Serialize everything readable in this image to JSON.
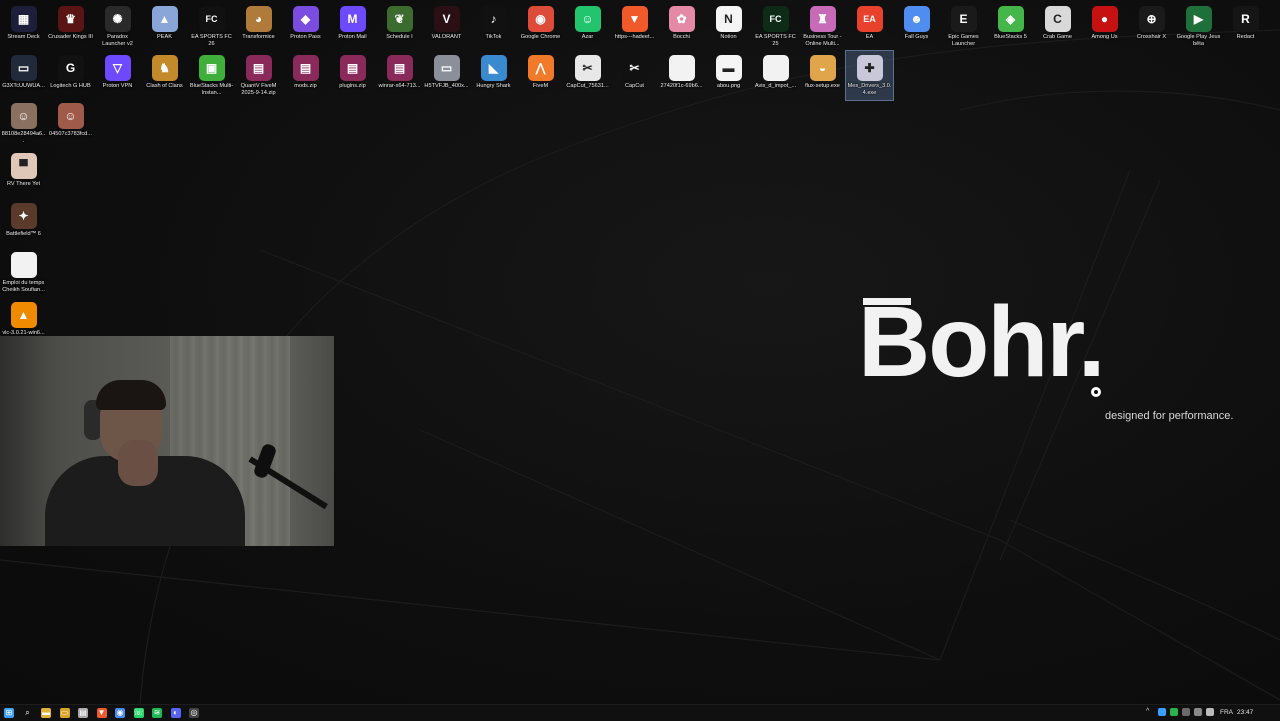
{
  "brand": {
    "name": "Bohr.",
    "tagline": "designed for performance."
  },
  "desktop_icons": [
    {
      "label": "Stream Deck",
      "icon": "stream-deck-icon",
      "color": "#1d1f3a",
      "glyph": "▦"
    },
    {
      "label": "Crusader Kings III",
      "icon": "crusader-kings-icon",
      "color": "#5a1414",
      "glyph": "♛"
    },
    {
      "label": "Paradox Launcher v2",
      "icon": "paradox-launcher-icon",
      "color": "#2a2a2a",
      "glyph": "✺"
    },
    {
      "label": "PEAK",
      "icon": "peak-icon",
      "color": "#8aa6d8",
      "glyph": "▲"
    },
    {
      "label": "EA SPORTS FC 26",
      "icon": "ea-fc26-icon",
      "color": "#111111",
      "glyph": "FC"
    },
    {
      "label": "Transformice",
      "icon": "transformice-icon",
      "color": "#b07a3a",
      "glyph": "◕"
    },
    {
      "label": "Proton Pass",
      "icon": "proton-pass-icon",
      "color": "#7b4ce0",
      "glyph": "◆"
    },
    {
      "label": "Proton Mail",
      "icon": "proton-mail-icon",
      "color": "#6d4aff",
      "glyph": "M"
    },
    {
      "label": "Schedule I",
      "icon": "schedule-one-icon",
      "color": "#3b6b2f",
      "glyph": "❦"
    },
    {
      "label": "VALORANT",
      "icon": "valorant-icon",
      "color": "#2a0f14",
      "glyph": "V"
    },
    {
      "label": "TikTok",
      "icon": "tiktok-icon",
      "color": "#111111",
      "glyph": "♪"
    },
    {
      "label": "Google Chrome",
      "icon": "chrome-icon",
      "color": "#dd4b39",
      "glyph": "◉"
    },
    {
      "label": "Azar",
      "icon": "azar-icon",
      "color": "#22c56e",
      "glyph": "☺"
    },
    {
      "label": "https---hadeet...",
      "icon": "brave-icon",
      "color": "#f0592a",
      "glyph": "▼"
    },
    {
      "label": "Bocchi",
      "icon": "bocchi-icon",
      "color": "#e58aa6",
      "glyph": "✿"
    },
    {
      "label": "Notion",
      "icon": "notion-icon",
      "color": "#f5f5f5",
      "glyph": "N"
    },
    {
      "label": "EA SPORTS FC 25",
      "icon": "ea-fc25-icon",
      "color": "#0d2b17",
      "glyph": "FC"
    },
    {
      "label": "Business Tour - Online Multi...",
      "icon": "business-tour-icon",
      "color": "#c76ab8",
      "glyph": "♜"
    },
    {
      "label": "EA",
      "icon": "ea-icon",
      "color": "#e8412c",
      "glyph": "EA"
    },
    {
      "label": "Fall Guys",
      "icon": "fall-guys-icon",
      "color": "#4f8df0",
      "glyph": "☻"
    },
    {
      "label": "Epic Games Launcher",
      "icon": "epic-games-icon",
      "color": "#1a1a1a",
      "glyph": "E"
    },
    {
      "label": "BlueStacks 5",
      "icon": "bluestacks-icon",
      "color": "#45b649",
      "glyph": "◈"
    },
    {
      "label": "Crab Game",
      "icon": "crab-game-icon",
      "color": "#d9d9d9",
      "glyph": "C"
    },
    {
      "label": "Among Us",
      "icon": "among-us-icon",
      "color": "#c51111",
      "glyph": "●"
    },
    {
      "label": "Crosshair X",
      "icon": "crosshair-x-icon",
      "color": "#1a1a1a",
      "glyph": "⊕"
    },
    {
      "label": "Google Play Jeux bêta",
      "icon": "google-play-icon",
      "color": "#1f6f3a",
      "glyph": "▶"
    },
    {
      "label": "Redact",
      "icon": "redact-icon",
      "color": "#151515",
      "glyph": "R"
    },
    {
      "label": "G3XTcUUWUA...",
      "icon": "image-file-icon",
      "color": "#202a3a",
      "glyph": "▭"
    },
    {
      "label": "Logitech G HUB",
      "icon": "logitech-ghub-icon",
      "color": "#111111",
      "glyph": "G"
    },
    {
      "label": "Proton VPN",
      "icon": "proton-vpn-icon",
      "color": "#6d4aff",
      "glyph": "▽"
    },
    {
      "label": "Clash of Clans",
      "icon": "clash-of-clans-icon",
      "color": "#c28a2b",
      "glyph": "♞"
    },
    {
      "label": "BlueStacks Multi-Instan...",
      "icon": "bluestacks-multi-icon",
      "color": "#3fae3a",
      "glyph": "▣"
    },
    {
      "label": "QuantV FiveM 2025-9-14.zip",
      "icon": "winrar-archive-icon",
      "color": "#8a2a5a",
      "glyph": "▤"
    },
    {
      "label": "mods.zip",
      "icon": "winrar-archive-icon",
      "color": "#8a2a5a",
      "glyph": "▤"
    },
    {
      "label": "plugins.zip",
      "icon": "winrar-archive-icon",
      "color": "#8a2a5a",
      "glyph": "▤"
    },
    {
      "label": "winrar-x64-713...",
      "icon": "winrar-installer-icon",
      "color": "#8a2a5a",
      "glyph": "▤"
    },
    {
      "label": "H5TVFJB_400x...",
      "icon": "image-file-icon",
      "color": "#8a8f99",
      "glyph": "▭"
    },
    {
      "label": "Hungry Shark",
      "icon": "hungry-shark-icon",
      "color": "#3a8ad0",
      "glyph": "◣"
    },
    {
      "label": "FiveM",
      "icon": "fivem-icon",
      "color": "#f07a2a",
      "glyph": "⋀"
    },
    {
      "label": "CapCut_75631...",
      "icon": "capcut-installer-icon",
      "color": "#e8e8e8",
      "glyph": "✂"
    },
    {
      "label": "CapCut",
      "icon": "capcut-icon",
      "color": "#111111",
      "glyph": "✂"
    },
    {
      "label": "27420f1c-69b6...",
      "icon": "blank-file-icon",
      "color": "#f2f2f2",
      "glyph": ""
    },
    {
      "label": "abou.png",
      "icon": "image-file-icon",
      "color": "#f5f5f5",
      "glyph": "▬"
    },
    {
      "label": "Avis_d_impot_...",
      "icon": "document-file-icon",
      "color": "#f2f2f2",
      "glyph": ""
    },
    {
      "label": "flux-setup.exe",
      "icon": "flux-icon",
      "color": "#e0a44a",
      "glyph": "◒"
    },
    {
      "label": "Mes_Drivers_3.0.4.exe",
      "icon": "drivers-installer-icon",
      "color": "#c8c8d8",
      "glyph": "✚",
      "selected": true
    },
    {
      "label": "88108e28494a6...",
      "icon": "photo-file-icon",
      "color": "#8a7060",
      "glyph": "☺"
    },
    {
      "label": "04507c3783fcd...",
      "icon": "photo-file-icon",
      "color": "#a05a4a",
      "glyph": "☺"
    },
    {
      "label": "RV There Yet",
      "icon": "rv-there-yet-icon",
      "color": "#e0c8b8",
      "glyph": "▀"
    },
    {
      "label": "Battlefield™ 6",
      "icon": "battlefield-icon",
      "color": "#5a3a2a",
      "glyph": "✦"
    },
    {
      "label": "Emploi du temps Cheikh Soufian...",
      "icon": "document-file-icon",
      "color": "#f2f2f2",
      "glyph": ""
    },
    {
      "label": "vlc-3.0.21-win6...",
      "icon": "vlc-icon",
      "color": "#f08a00",
      "glyph": "▲"
    }
  ],
  "taskbar": {
    "apps": [
      {
        "icon": "windows-start-icon",
        "color": "#3aa0ff",
        "glyph": "⊞"
      },
      {
        "icon": "search-icon",
        "color": "#101010",
        "glyph": "⌕"
      },
      {
        "icon": "file-explorer-icon",
        "color": "#e0b23a",
        "glyph": "▬"
      },
      {
        "icon": "folder-icon",
        "color": "#d9a62a",
        "glyph": "▭"
      },
      {
        "icon": "notes-icon",
        "color": "#aaaaaa",
        "glyph": "▤"
      },
      {
        "icon": "brave-taskbar-icon",
        "color": "#f0592a",
        "glyph": "▼"
      },
      {
        "icon": "chrome-taskbar-icon",
        "color": "#4a8af4",
        "glyph": "◉"
      },
      {
        "icon": "whatsapp-icon",
        "color": "#25d366",
        "glyph": "☏"
      },
      {
        "icon": "spotify-icon",
        "color": "#1db954",
        "glyph": "≋"
      },
      {
        "icon": "discord-icon",
        "color": "#5865f2",
        "glyph": "◐"
      },
      {
        "icon": "obs-icon",
        "color": "#444444",
        "glyph": "◎"
      }
    ],
    "tray": {
      "language": "FRA",
      "time": "23:47"
    }
  }
}
